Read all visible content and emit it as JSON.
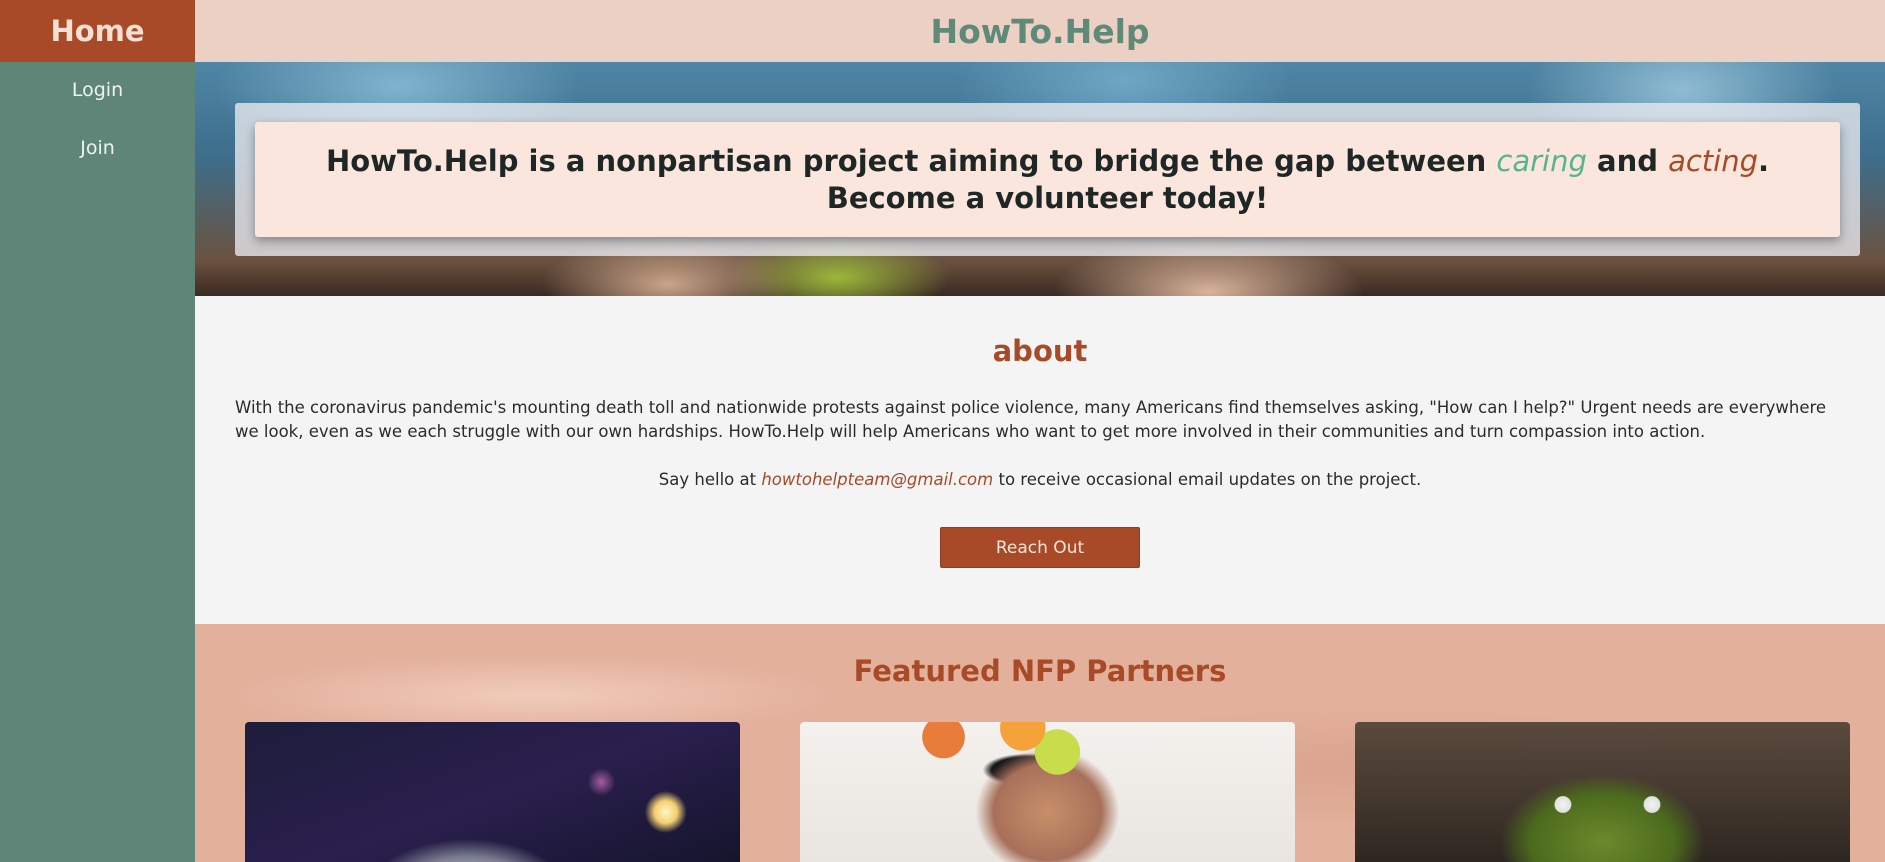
{
  "sidebar": {
    "home_label": "Home",
    "items": [
      {
        "label": "Login"
      },
      {
        "label": "Join"
      }
    ]
  },
  "header": {
    "title": "HowTo.Help"
  },
  "hero": {
    "text_before": "HowTo.Help is a nonpartisan project aiming to bridge the gap between ",
    "caring": "caring",
    "text_and": " and ",
    "acting": "acting",
    "text_after": ". Become a volunteer today!"
  },
  "about": {
    "heading": "about",
    "paragraph": "With the coronavirus pandemic's mounting death toll and nationwide protests against police violence, many Americans find themselves asking, \"How can I help?\" Urgent needs are everywhere we look, even as we each struggle with our own hardships. HowTo.Help will help Americans who want to get more involved in their communities and turn compassion into action.",
    "hello_prefix": "Say hello at ",
    "email": "howtohelpteam@gmail.com",
    "hello_suffix": " to receive occasional email updates on the project.",
    "button_label": "Reach Out"
  },
  "partners": {
    "heading": "Featured NFP Partners"
  },
  "colors": {
    "sidebar": "#5f8578",
    "accent": "#a84a28",
    "title_green": "#5f8a7a",
    "caring_green": "#58b38f"
  }
}
